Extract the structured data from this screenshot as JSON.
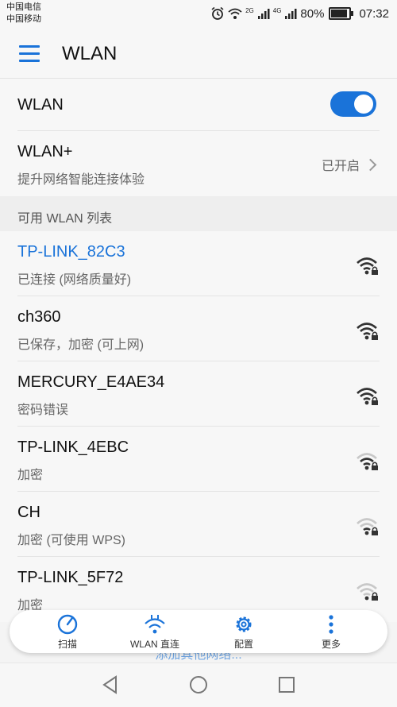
{
  "status_bar": {
    "carrier1": "中国电信",
    "carrier2": "中国移动",
    "net1": "2G",
    "net2": "4G",
    "battery_percent": "80%",
    "battery_level": 0.8,
    "time": "07:32"
  },
  "app_bar": {
    "title": "WLAN"
  },
  "wlan_toggle": {
    "label": "WLAN",
    "enabled": true
  },
  "wlan_plus": {
    "title": "WLAN+",
    "subtitle": "提升网络智能连接体验",
    "status": "已开启"
  },
  "section_header": "可用 WLAN 列表",
  "networks": [
    {
      "name": "TP-LINK_82C3",
      "status": "已连接 (网络质量好)",
      "connected": true,
      "signal": 4
    },
    {
      "name": "ch360",
      "status": "已保存，加密 (可上网)",
      "connected": false,
      "signal": 4
    },
    {
      "name": "MERCURY_E4AE34",
      "status": "密码错误",
      "connected": false,
      "signal": 4
    },
    {
      "name": "TP-LINK_4EBC",
      "status": "加密",
      "connected": false,
      "signal": 3
    },
    {
      "name": "CH",
      "status": "加密 (可使用 WPS)",
      "connected": false,
      "signal": 2
    },
    {
      "name": "TP-LINK_5F72",
      "status": "加密",
      "connected": false,
      "signal": 1
    }
  ],
  "add_other": "添加其他网络...",
  "dock": {
    "scan": "扫描",
    "direct": "WLAN 直连",
    "config": "配置",
    "more": "更多"
  },
  "colors": {
    "accent": "#1a73d9",
    "connected_text": "#1a73d9"
  }
}
